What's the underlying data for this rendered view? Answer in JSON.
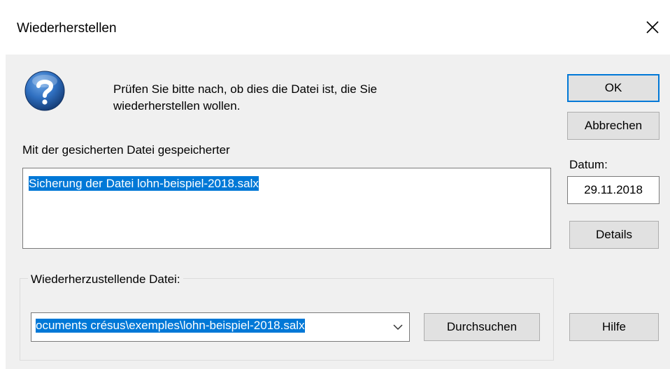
{
  "window": {
    "title": "Wiederherstellen",
    "close_icon": "close-icon"
  },
  "message": {
    "icon": "question-icon",
    "line1": "Prüfen Sie bitte nach, ob dies die Datei ist, die Sie",
    "line2": "wiederherstellen wollen."
  },
  "saved_info": {
    "label": "Mit der gesicherten Datei gespeicherter",
    "text": "Sicherung der Datei lohn-beispiel-2018.salx"
  },
  "buttons": {
    "ok": "OK",
    "cancel": "Abbrechen",
    "details": "Details",
    "browse": "Durchsuchen",
    "help": "Hilfe"
  },
  "date": {
    "label": "Datum:",
    "value": "29.11.2018"
  },
  "restore_file": {
    "group_label": "Wiederherzustellende Datei:",
    "value": "ocuments crésus\\exemples\\lohn-beispiel-2018.salx",
    "dropdown_icon": "chevron-down-icon"
  },
  "colors": {
    "selection": "#0078d7",
    "default_button_border": "#0078d7",
    "icon_blue": "#1f5fa8"
  }
}
